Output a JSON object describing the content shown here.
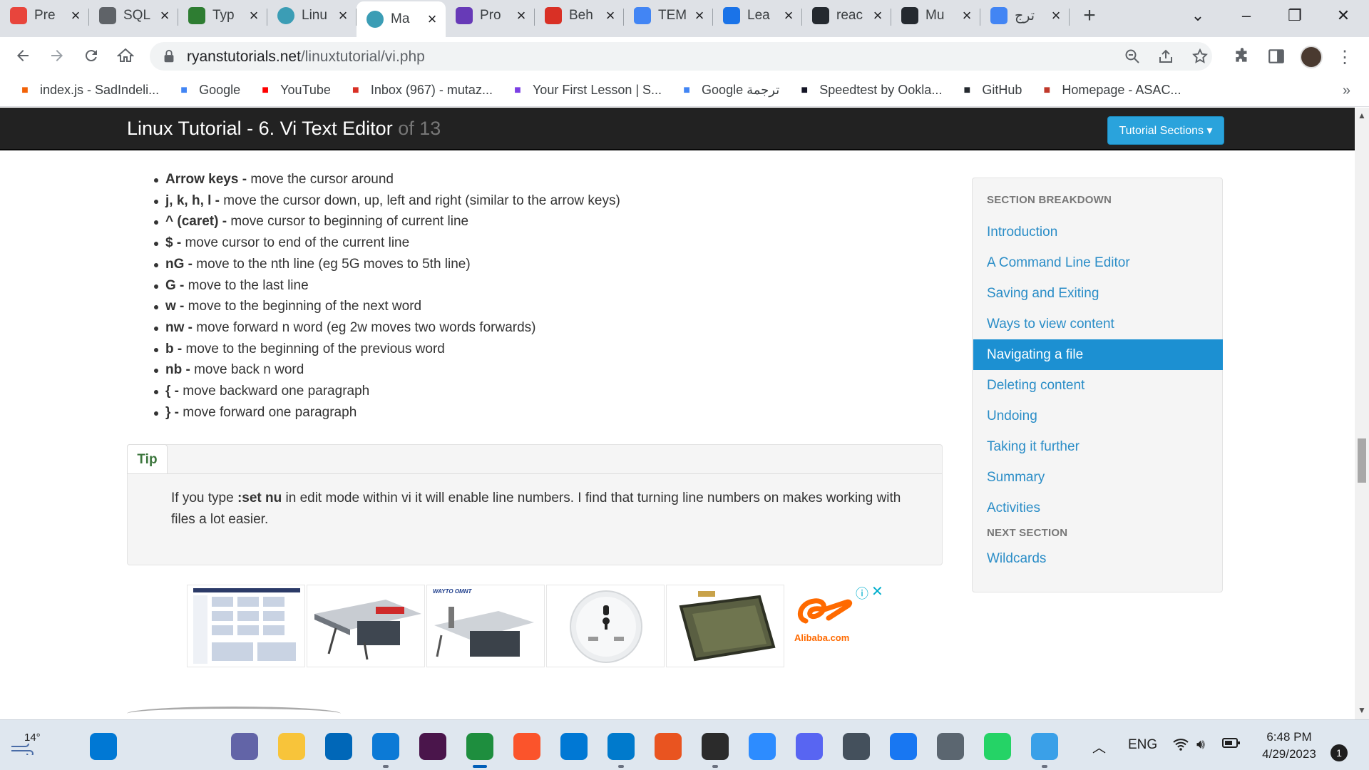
{
  "browser": {
    "tabs": [
      {
        "label": "Pre",
        "favicon": "asterisk-icon",
        "color": "#e8453c"
      },
      {
        "label": "SQL",
        "favicon": "database-icon",
        "color": "#5f6368"
      },
      {
        "label": "Typ",
        "favicon": "t-icon",
        "color": "#2e7d32"
      },
      {
        "label": "Linu",
        "favicon": "globe-icon",
        "color": "#3b9db5"
      },
      {
        "label": "Ma",
        "favicon": "globe-icon",
        "color": "#3b9db5"
      },
      {
        "label": "Pro",
        "favicon": "form-icon",
        "color": "#673ab7"
      },
      {
        "label": "Beh",
        "favicon": "shield-icon",
        "color": "#d93025"
      },
      {
        "label": "TEM",
        "favicon": "docs-icon",
        "color": "#4285f4"
      },
      {
        "label": "Lea",
        "favicon": "puzzle-icon",
        "color": "#1a73e8"
      },
      {
        "label": "reac",
        "favicon": "github-icon",
        "color": "#24292f"
      },
      {
        "label": "Mu",
        "favicon": "github-icon",
        "color": "#24292f"
      },
      {
        "label": "ترج",
        "favicon": "translate-icon",
        "color": "#4285f4"
      }
    ],
    "active_tab_index": 4,
    "url_domain": "ryanstutorials.net",
    "url_path": "/linuxtutorial/vi.php",
    "bookmarks": [
      {
        "label": "index.js - SadIndeli...",
        "icon": "replit-icon",
        "color": "#f26207"
      },
      {
        "label": "Google",
        "icon": "google-icon",
        "color": "#4285f4"
      },
      {
        "label": "YouTube",
        "icon": "youtube-icon",
        "color": "#ff0000"
      },
      {
        "label": "Inbox (967) - mutaz...",
        "icon": "gmail-icon",
        "color": "#d93025"
      },
      {
        "label": "Your First Lesson | S...",
        "icon": "lesson-icon",
        "color": "#7b3fe4"
      },
      {
        "label": "Google ترجمة",
        "icon": "translate-icon",
        "color": "#4285f4"
      },
      {
        "label": "Speedtest by Ookla...",
        "icon": "speedtest-icon",
        "color": "#141526"
      },
      {
        "label": "GitHub",
        "icon": "github-icon",
        "color": "#24292f"
      },
      {
        "label": "Homepage - ASAC...",
        "icon": "asac-icon",
        "color": "#c0392b"
      }
    ],
    "bookmarks_more": "»"
  },
  "site": {
    "title": "Linux Tutorial - 6. Vi Text Editor",
    "title_suffix": "of 13",
    "sections_button": "Tutorial Sections ▾"
  },
  "commands": [
    {
      "key": "Arrow keys -",
      "desc": " move the cursor around"
    },
    {
      "key": "j, k, h, l -",
      "desc": " move the cursor down, up, left and right (similar to the arrow keys)"
    },
    {
      "key": "^ (caret) -",
      "desc": " move cursor to beginning of current line"
    },
    {
      "key": "$ -",
      "desc": " move cursor to end of the current line"
    },
    {
      "key": "nG -",
      "desc": " move to the nth line (eg 5G moves to 5th line)"
    },
    {
      "key": "G -",
      "desc": " move to the last line"
    },
    {
      "key": "w -",
      "desc": " move to the beginning of the next word"
    },
    {
      "key": "nw -",
      "desc": " move forward n word (eg 2w moves two words forwards)"
    },
    {
      "key": "b -",
      "desc": " move to the beginning of the previous word"
    },
    {
      "key": "nb -",
      "desc": " move back n word"
    },
    {
      "key": "{ -",
      "desc": " move backward one paragraph"
    },
    {
      "key": "} -",
      "desc": " move forward one paragraph"
    }
  ],
  "tip": {
    "label": "Tip",
    "text_before": "If you type ",
    "command": ":set nu",
    "text_after": " in edit mode within vi it will enable line numbers. I find that turning line numbers on makes working with files a lot easier."
  },
  "ad": {
    "info_icon": "ⓘ",
    "close_icon": "✕",
    "brand": "Alibaba.com",
    "mini_brand": "WAYTO OMNT"
  },
  "sidebar": {
    "heading": "SECTION BREAKDOWN",
    "items": [
      "Introduction",
      "A Command Line Editor",
      "Saving and Exiting",
      "Ways to view content",
      "Navigating a file",
      "Deleting content",
      "Undoing",
      "Taking it further",
      "Summary",
      "Activities"
    ],
    "active_index": 4,
    "next_heading": "NEXT SECTION",
    "next_item": "Wildcards"
  },
  "taskbar": {
    "weather": "14°",
    "language": "ENG",
    "time": "6:48 PM",
    "date": "4/29/2023",
    "notifications": "1",
    "apps": [
      {
        "name": "start-icon",
        "color": "#0078d4"
      },
      {
        "name": "search-icon",
        "color": "#1f1f1f"
      },
      {
        "name": "task-view-icon",
        "color": "#1f1f1f"
      },
      {
        "name": "teams-chat-icon",
        "color": "#6264a7"
      },
      {
        "name": "file-explorer-icon",
        "color": "#f8c43a"
      },
      {
        "name": "microsoft-store-icon",
        "color": "#0067b8"
      },
      {
        "name": "edge-icon",
        "color": "#0c7ad6"
      },
      {
        "name": "slack-icon",
        "color": "#4a154b"
      },
      {
        "name": "chrome-icon",
        "color": "#1e8e3e"
      },
      {
        "name": "brave-icon",
        "color": "#fb542b"
      },
      {
        "name": "mail-icon",
        "color": "#0078d4"
      },
      {
        "name": "vscode-icon",
        "color": "#007acc"
      },
      {
        "name": "ubuntu-icon",
        "color": "#e95420"
      },
      {
        "name": "terminal-icon",
        "color": "#2b2b2b"
      },
      {
        "name": "zoom-icon",
        "color": "#2d8cff"
      },
      {
        "name": "discord-icon",
        "color": "#5865f2"
      },
      {
        "name": "camera-icon",
        "color": "#44505c"
      },
      {
        "name": "facebook-icon",
        "color": "#1877f2"
      },
      {
        "name": "settings-icon",
        "color": "#5b6670"
      },
      {
        "name": "whatsapp-icon",
        "color": "#25d366"
      },
      {
        "name": "paint-icon",
        "color": "#3aa0e8"
      }
    ]
  }
}
